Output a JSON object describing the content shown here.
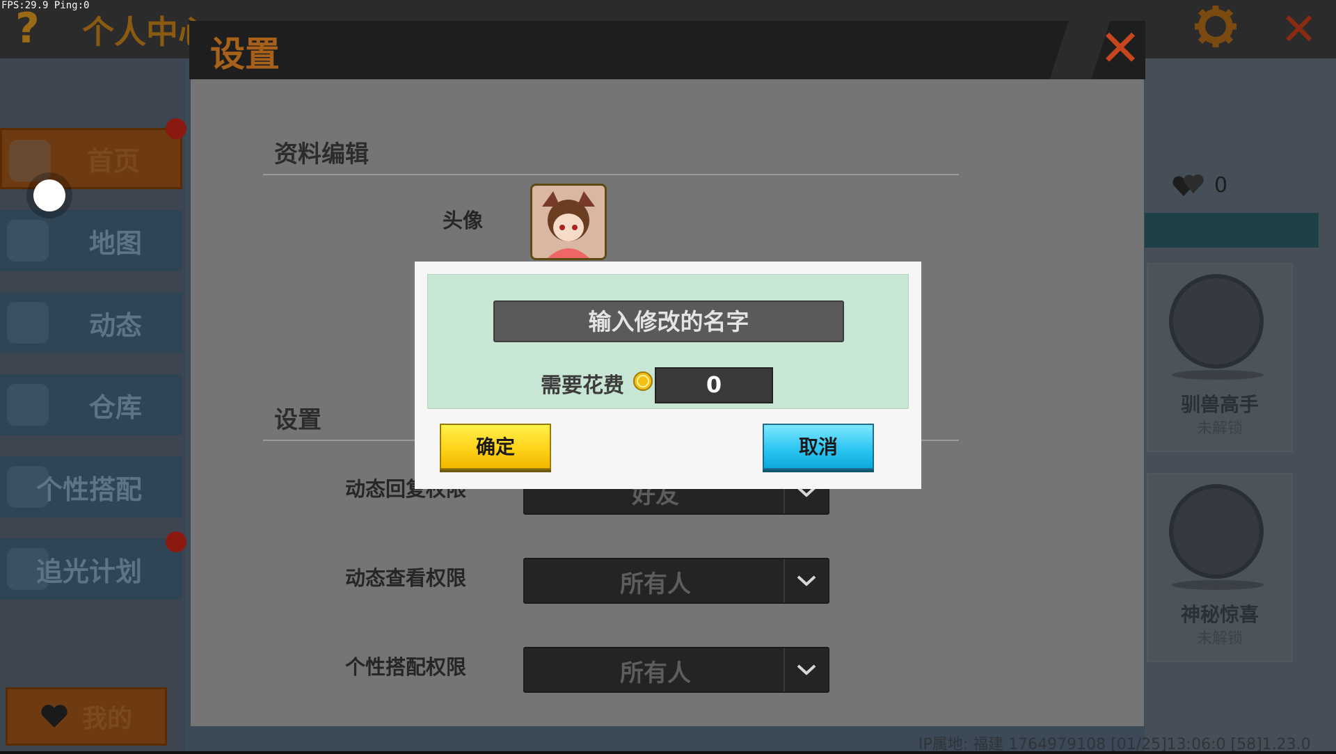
{
  "status": {
    "fps_text": "FPS:29.9  Ping:0"
  },
  "background": {
    "title": "个人中心",
    "sidebar": [
      {
        "label": "首页"
      },
      {
        "label": "地图"
      },
      {
        "label": "动态"
      },
      {
        "label": "仓库"
      },
      {
        "label": "个性搭配"
      },
      {
        "label": "追光计划"
      }
    ],
    "my_label": "我的",
    "likes_count": "0",
    "achievements": [
      {
        "name": "驯兽高手",
        "status": "未解锁"
      },
      {
        "name": "神秘惊喜",
        "status": "未解锁"
      }
    ],
    "bottom_info": "IP属地: 福建  1764979108  [01/25]13:06:0  [58]1.23.0"
  },
  "settings": {
    "title": "设置",
    "profile_section": "资料编辑",
    "avatar_label": "头像",
    "settings_section": "设置",
    "rows": [
      {
        "label": "动态回复权限",
        "value": "好友"
      },
      {
        "label": "动态查看权限",
        "value": "所有人"
      },
      {
        "label": "个性搭配权限",
        "value": "所有人"
      }
    ]
  },
  "dialog": {
    "name_placeholder": "输入修改的名字",
    "cost_label": "需要花费",
    "cost_value": "0",
    "confirm_label": "确定",
    "cancel_label": "取消"
  },
  "colors": {
    "accent_orange": "#a8611a",
    "close_red": "#c8461e",
    "confirm_yellow": "#ffd21a",
    "cancel_blue": "#2ec6f2",
    "dialog_green": "#c8e6d4"
  }
}
